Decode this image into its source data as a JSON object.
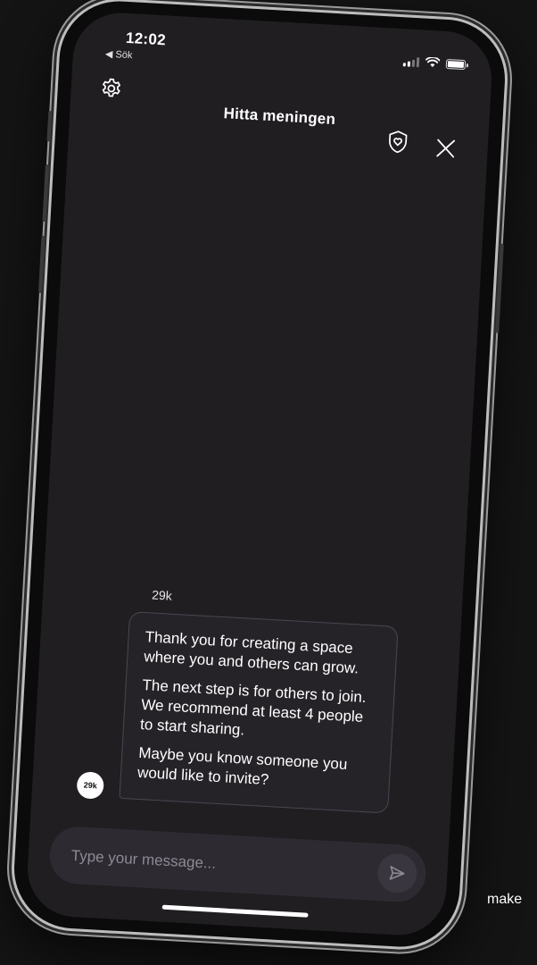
{
  "status_bar": {
    "time": "12:02",
    "back_label": "◀ Sök"
  },
  "header": {
    "title": "Hitta meningen",
    "settings_icon": "gear-icon",
    "safety_icon": "shield-heart-icon",
    "close_icon": "close-icon"
  },
  "chat": {
    "sender_name": "29k",
    "avatar_label": "29k",
    "messages": [
      "Thank you for creating a space where you and others can grow.",
      "The next step is for others to join. We recommend at least 4 people to start sharing.",
      "Maybe you know someone you would like to invite?"
    ]
  },
  "composer": {
    "placeholder": "Type your message...",
    "send_icon": "send-icon"
  },
  "caption": "make",
  "colors": {
    "background": "#141414",
    "screen": "#211e22",
    "bubble": "#262328",
    "bubble_border": "#4a4650",
    "composer": "#2e2a32",
    "text": "#ffffff",
    "placeholder": "#8e8a95"
  }
}
